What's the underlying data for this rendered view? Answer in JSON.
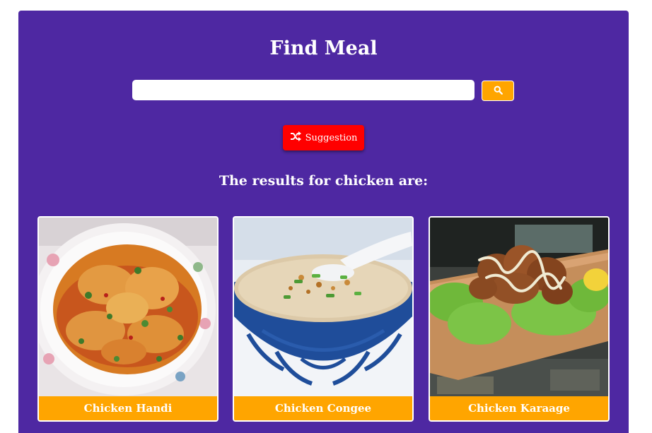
{
  "header": {
    "title": "Find Meal"
  },
  "search": {
    "value": "",
    "placeholder": "",
    "button_icon": "search-icon"
  },
  "suggestion": {
    "label": "Suggestion",
    "icon": "shuffle-icon"
  },
  "results": {
    "heading": "The results for chicken are:",
    "meals": [
      {
        "name": "Chicken Handi",
        "image": "chicken-curry-bowl"
      },
      {
        "name": "Chicken Congee",
        "image": "rice-porridge-bowl"
      },
      {
        "name": "Chicken Karaage",
        "image": "fried-chicken-lettuce"
      }
    ]
  },
  "colors": {
    "background": "#4e28a2",
    "accent": "#ffa500",
    "suggestion": "#ff0000",
    "text": "#ffffff"
  }
}
